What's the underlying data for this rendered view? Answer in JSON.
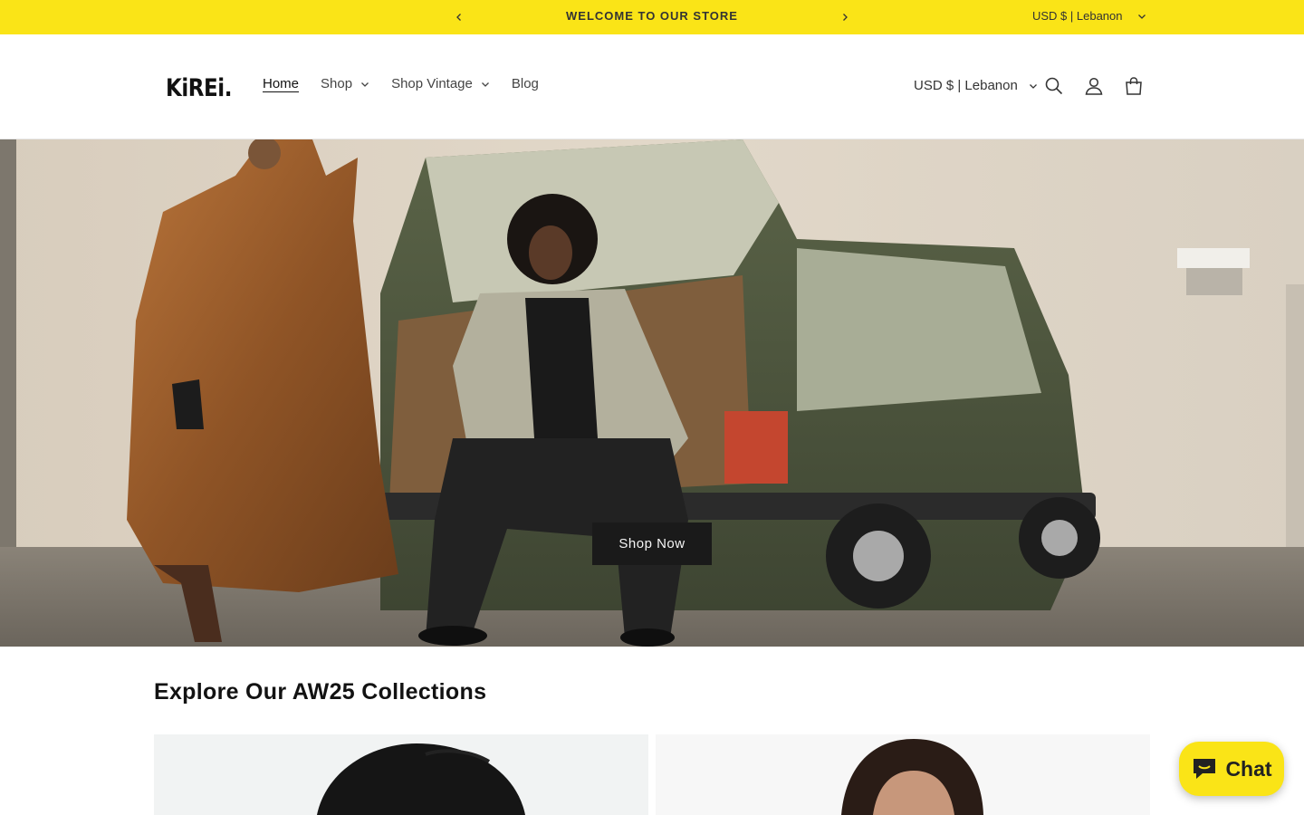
{
  "colors": {
    "announcement_bg": "#fae417",
    "button_bg": "#1a1a1a",
    "chat_bg": "#fae417"
  },
  "announcement": {
    "text": "WELCOME TO OUR STORE",
    "prev_icon": "chevron-left-icon",
    "next_icon": "chevron-right-icon",
    "locale": "USD $ | Lebanon"
  },
  "header": {
    "logo": "KiREi.",
    "nav": [
      {
        "label": "Home",
        "active": true
      },
      {
        "label": "Shop",
        "dropdown": true
      },
      {
        "label": "Shop Vintage",
        "dropdown": true
      },
      {
        "label": "Blog"
      }
    ],
    "locale": "USD $ | Lebanon",
    "icons": [
      "search-icon",
      "account-icon",
      "cart-icon"
    ]
  },
  "hero": {
    "button": "Shop Now"
  },
  "collections": {
    "title": "Explore Our AW25 Collections"
  },
  "chat": {
    "label": "Chat",
    "icon": "chat-bubble-icon"
  }
}
